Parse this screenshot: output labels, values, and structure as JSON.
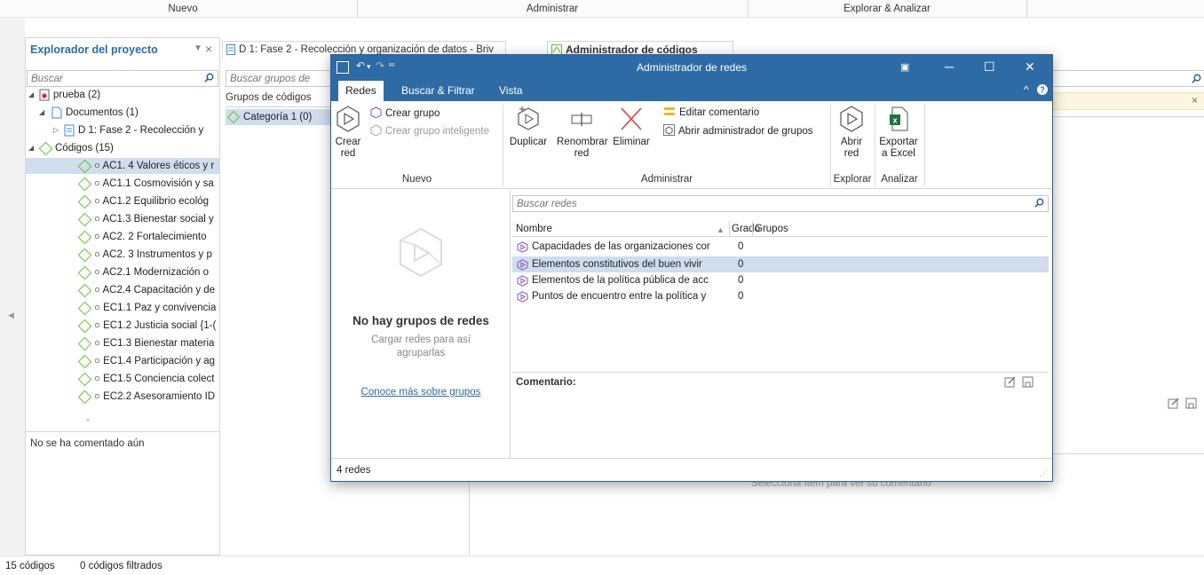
{
  "ribbon": {
    "group_nuevo": "Nuevo",
    "group_administrar": "Administrar",
    "group_explorar": "Explorar & Analizar"
  },
  "explorer": {
    "title": "Explorador del proyecto",
    "search_placeholder": "Buscar",
    "tree": [
      {
        "label": "prueba (2)"
      },
      {
        "label": "Documentos (1)"
      },
      {
        "label": "D 1: Fase 2 - Recolección y"
      },
      {
        "label": "Códigos (15)"
      }
    ],
    "codes": [
      "○ AC1. 4 Valores éticos y r",
      "○ AC1.1 Cosmovisión y sa",
      "○ AC1.2 Equilibrio ecológ",
      "○ AC1.3 Bienestar social y",
      "○ AC2. 2 Fortalecimiento",
      "○ AC2. 3 Instrumentos y p",
      "○ AC2.1 Modernización o",
      "○ AC2.4 Capacitación y de",
      "○ EC1.1 Paz y convivencia",
      "○ EC1.2 Justicia social {1-(",
      "○ EC1.3 Bienestar materia",
      "○ EC1.4 Participación y ag",
      "○ EC1.5 Conciencia colect",
      "○ EC2.2 Asesoramiento ID"
    ],
    "comment": "No se ha comentado aún"
  },
  "doc": {
    "tab": "D 1: Fase 2 - Recolección y organización de datos - Briv",
    "code_tab": "Administrador de códigos",
    "search_placeholder": "Buscar grupos de códi",
    "groups_header": "Grupos de códigos",
    "category": "Categoría 1 (0)",
    "hint": "Selecciona ítem para ver su comentario"
  },
  "status": {
    "codes": "15 códigos",
    "filtered": "0 códigos filtrados"
  },
  "dialog": {
    "title": "Administrador de redes",
    "tabs": [
      "Redes",
      "Buscar & Filtrar",
      "Vista"
    ],
    "ribbon": {
      "crear_red": "Crear red",
      "crear_grupo": "Crear grupo",
      "crear_grupo_inteligente": "Crear grupo inteligente",
      "duplicar": "Duplicar",
      "renombrar": "Renombrar red",
      "eliminar": "Eliminar",
      "editar_comentario": "Editar comentario",
      "abrir_admin_grupos": "Abrir administrador de grupos",
      "abrir_red": "Abrir red",
      "exportar": "Exportar a Excel",
      "group_nuevo": "Nuevo",
      "group_administrar": "Administrar",
      "group_explorar": "Explorar",
      "group_analizar": "Analizar"
    },
    "empty": {
      "title": "No hay grupos de redes",
      "subtitle": "Cargar redes para así agruparlas",
      "link": "Conoce más sobre grupos"
    },
    "search_placeholder": "Buscar redes",
    "columns": {
      "nombre": "Nombre",
      "grado": "Grado",
      "grupos": "Grupos"
    },
    "networks": [
      {
        "name": "Capacidades de las organizaciones cor",
        "grade": "0"
      },
      {
        "name": "Elementos constitutivos del buen vivir",
        "grade": "0"
      },
      {
        "name": "Elementos de la política pública de acc",
        "grade": "0"
      },
      {
        "name": "Puntos de encuentro entre la política y",
        "grade": "0"
      }
    ],
    "comment_label": "Comentario:",
    "status": "4 redes"
  }
}
